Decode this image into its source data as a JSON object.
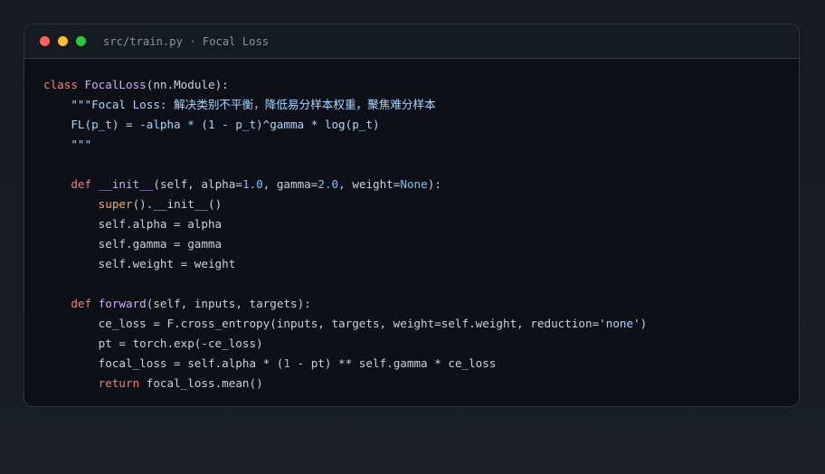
{
  "window": {
    "title": "src/train.py · Focal Loss",
    "controls": {
      "close_color": "#ff5f56",
      "minimize_color": "#ffbd2e",
      "maximize_color": "#27c93f"
    }
  },
  "code": {
    "language": "python",
    "lines": [
      [
        {
          "t": "class ",
          "c": "kw"
        },
        {
          "t": "FocalLoss",
          "c": "cls"
        },
        {
          "t": "(nn.Module):",
          "c": "tx"
        }
      ],
      [
        {
          "t": "    \"\"\"Focal Loss: 解决类别不平衡，降低易分样本权重，聚焦难分样本",
          "c": "str"
        }
      ],
      [
        {
          "t": "    FL(p_t) = -alpha * (1 - p_t)^gamma * log(p_t)",
          "c": "str"
        }
      ],
      [
        {
          "t": "    \"\"\"",
          "c": "str"
        }
      ],
      [
        {
          "t": "",
          "c": "tx"
        }
      ],
      [
        {
          "t": "    ",
          "c": "tx"
        },
        {
          "t": "def ",
          "c": "kw"
        },
        {
          "t": "__init__",
          "c": "fn"
        },
        {
          "t": "(self, alpha=",
          "c": "tx"
        },
        {
          "t": "1.0",
          "c": "num"
        },
        {
          "t": ", gamma=",
          "c": "tx"
        },
        {
          "t": "2.0",
          "c": "num"
        },
        {
          "t": ", weight=",
          "c": "tx"
        },
        {
          "t": "None",
          "c": "num"
        },
        {
          "t": "):",
          "c": "tx"
        }
      ],
      [
        {
          "t": "        ",
          "c": "tx"
        },
        {
          "t": "super",
          "c": "bi"
        },
        {
          "t": "().__init__()",
          "c": "tx"
        }
      ],
      [
        {
          "t": "        self.alpha = alpha",
          "c": "tx"
        }
      ],
      [
        {
          "t": "        self.gamma = gamma",
          "c": "tx"
        }
      ],
      [
        {
          "t": "        self.weight = weight",
          "c": "tx"
        }
      ],
      [
        {
          "t": "",
          "c": "tx"
        }
      ],
      [
        {
          "t": "    ",
          "c": "tx"
        },
        {
          "t": "def ",
          "c": "kw"
        },
        {
          "t": "forward",
          "c": "fn"
        },
        {
          "t": "(self, inputs, targets):",
          "c": "tx"
        }
      ],
      [
        {
          "t": "        ce_loss = F.cross_entropy(inputs, targets, weight=self.weight, reduction=",
          "c": "tx"
        },
        {
          "t": "'none'",
          "c": "str"
        },
        {
          "t": ")",
          "c": "tx"
        }
      ],
      [
        {
          "t": "        pt = torch.exp(-ce_loss)",
          "c": "tx"
        }
      ],
      [
        {
          "t": "        focal_loss = self.alpha * (",
          "c": "tx"
        },
        {
          "t": "1",
          "c": "num"
        },
        {
          "t": " - pt) ** self.gamma * ce_loss",
          "c": "tx"
        }
      ],
      [
        {
          "t": "        ",
          "c": "tx"
        },
        {
          "t": "return ",
          "c": "kw"
        },
        {
          "t": "focal_loss.mean()",
          "c": "tx"
        }
      ]
    ]
  }
}
